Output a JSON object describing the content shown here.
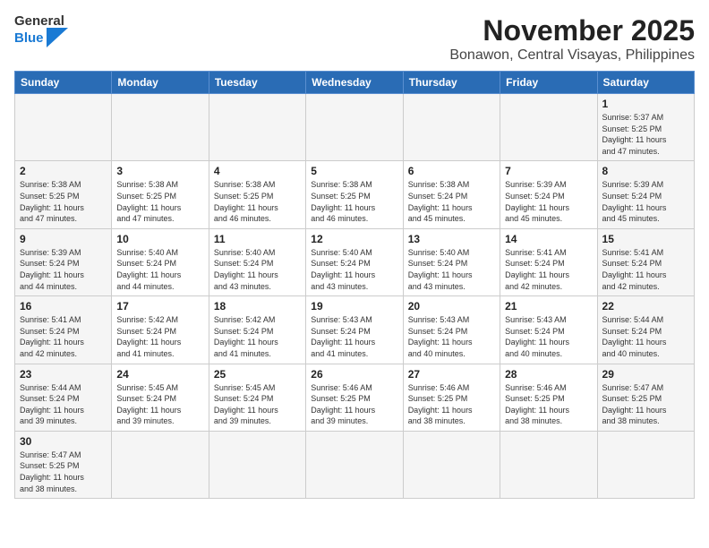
{
  "header": {
    "logo_general": "General",
    "logo_blue": "Blue",
    "month_title": "November 2025",
    "location": "Bonawon, Central Visayas, Philippines"
  },
  "weekdays": [
    "Sunday",
    "Monday",
    "Tuesday",
    "Wednesday",
    "Thursday",
    "Friday",
    "Saturday"
  ],
  "days": [
    {
      "date": "",
      "info": ""
    },
    {
      "date": "",
      "info": ""
    },
    {
      "date": "",
      "info": ""
    },
    {
      "date": "",
      "info": ""
    },
    {
      "date": "",
      "info": ""
    },
    {
      "date": "",
      "info": ""
    },
    {
      "date": "1",
      "info": "Sunrise: 5:37 AM\nSunset: 5:25 PM\nDaylight: 11 hours\nand 47 minutes."
    },
    {
      "date": "2",
      "info": "Sunrise: 5:38 AM\nSunset: 5:25 PM\nDaylight: 11 hours\nand 47 minutes."
    },
    {
      "date": "3",
      "info": "Sunrise: 5:38 AM\nSunset: 5:25 PM\nDaylight: 11 hours\nand 47 minutes."
    },
    {
      "date": "4",
      "info": "Sunrise: 5:38 AM\nSunset: 5:25 PM\nDaylight: 11 hours\nand 46 minutes."
    },
    {
      "date": "5",
      "info": "Sunrise: 5:38 AM\nSunset: 5:25 PM\nDaylight: 11 hours\nand 46 minutes."
    },
    {
      "date": "6",
      "info": "Sunrise: 5:38 AM\nSunset: 5:24 PM\nDaylight: 11 hours\nand 45 minutes."
    },
    {
      "date": "7",
      "info": "Sunrise: 5:39 AM\nSunset: 5:24 PM\nDaylight: 11 hours\nand 45 minutes."
    },
    {
      "date": "8",
      "info": "Sunrise: 5:39 AM\nSunset: 5:24 PM\nDaylight: 11 hours\nand 45 minutes."
    },
    {
      "date": "9",
      "info": "Sunrise: 5:39 AM\nSunset: 5:24 PM\nDaylight: 11 hours\nand 44 minutes."
    },
    {
      "date": "10",
      "info": "Sunrise: 5:40 AM\nSunset: 5:24 PM\nDaylight: 11 hours\nand 44 minutes."
    },
    {
      "date": "11",
      "info": "Sunrise: 5:40 AM\nSunset: 5:24 PM\nDaylight: 11 hours\nand 43 minutes."
    },
    {
      "date": "12",
      "info": "Sunrise: 5:40 AM\nSunset: 5:24 PM\nDaylight: 11 hours\nand 43 minutes."
    },
    {
      "date": "13",
      "info": "Sunrise: 5:40 AM\nSunset: 5:24 PM\nDaylight: 11 hours\nand 43 minutes."
    },
    {
      "date": "14",
      "info": "Sunrise: 5:41 AM\nSunset: 5:24 PM\nDaylight: 11 hours\nand 42 minutes."
    },
    {
      "date": "15",
      "info": "Sunrise: 5:41 AM\nSunset: 5:24 PM\nDaylight: 11 hours\nand 42 minutes."
    },
    {
      "date": "16",
      "info": "Sunrise: 5:41 AM\nSunset: 5:24 PM\nDaylight: 11 hours\nand 42 minutes."
    },
    {
      "date": "17",
      "info": "Sunrise: 5:42 AM\nSunset: 5:24 PM\nDaylight: 11 hours\nand 41 minutes."
    },
    {
      "date": "18",
      "info": "Sunrise: 5:42 AM\nSunset: 5:24 PM\nDaylight: 11 hours\nand 41 minutes."
    },
    {
      "date": "19",
      "info": "Sunrise: 5:43 AM\nSunset: 5:24 PM\nDaylight: 11 hours\nand 41 minutes."
    },
    {
      "date": "20",
      "info": "Sunrise: 5:43 AM\nSunset: 5:24 PM\nDaylight: 11 hours\nand 40 minutes."
    },
    {
      "date": "21",
      "info": "Sunrise: 5:43 AM\nSunset: 5:24 PM\nDaylight: 11 hours\nand 40 minutes."
    },
    {
      "date": "22",
      "info": "Sunrise: 5:44 AM\nSunset: 5:24 PM\nDaylight: 11 hours\nand 40 minutes."
    },
    {
      "date": "23",
      "info": "Sunrise: 5:44 AM\nSunset: 5:24 PM\nDaylight: 11 hours\nand 39 minutes."
    },
    {
      "date": "24",
      "info": "Sunrise: 5:45 AM\nSunset: 5:24 PM\nDaylight: 11 hours\nand 39 minutes."
    },
    {
      "date": "25",
      "info": "Sunrise: 5:45 AM\nSunset: 5:24 PM\nDaylight: 11 hours\nand 39 minutes."
    },
    {
      "date": "26",
      "info": "Sunrise: 5:46 AM\nSunset: 5:25 PM\nDaylight: 11 hours\nand 39 minutes."
    },
    {
      "date": "27",
      "info": "Sunrise: 5:46 AM\nSunset: 5:25 PM\nDaylight: 11 hours\nand 38 minutes."
    },
    {
      "date": "28",
      "info": "Sunrise: 5:46 AM\nSunset: 5:25 PM\nDaylight: 11 hours\nand 38 minutes."
    },
    {
      "date": "29",
      "info": "Sunrise: 5:47 AM\nSunset: 5:25 PM\nDaylight: 11 hours\nand 38 minutes."
    },
    {
      "date": "30",
      "info": "Sunrise: 5:47 AM\nSunset: 5:25 PM\nDaylight: 11 hours\nand 38 minutes."
    },
    {
      "date": "",
      "info": ""
    },
    {
      "date": "",
      "info": ""
    },
    {
      "date": "",
      "info": ""
    },
    {
      "date": "",
      "info": ""
    },
    {
      "date": "",
      "info": ""
    }
  ]
}
